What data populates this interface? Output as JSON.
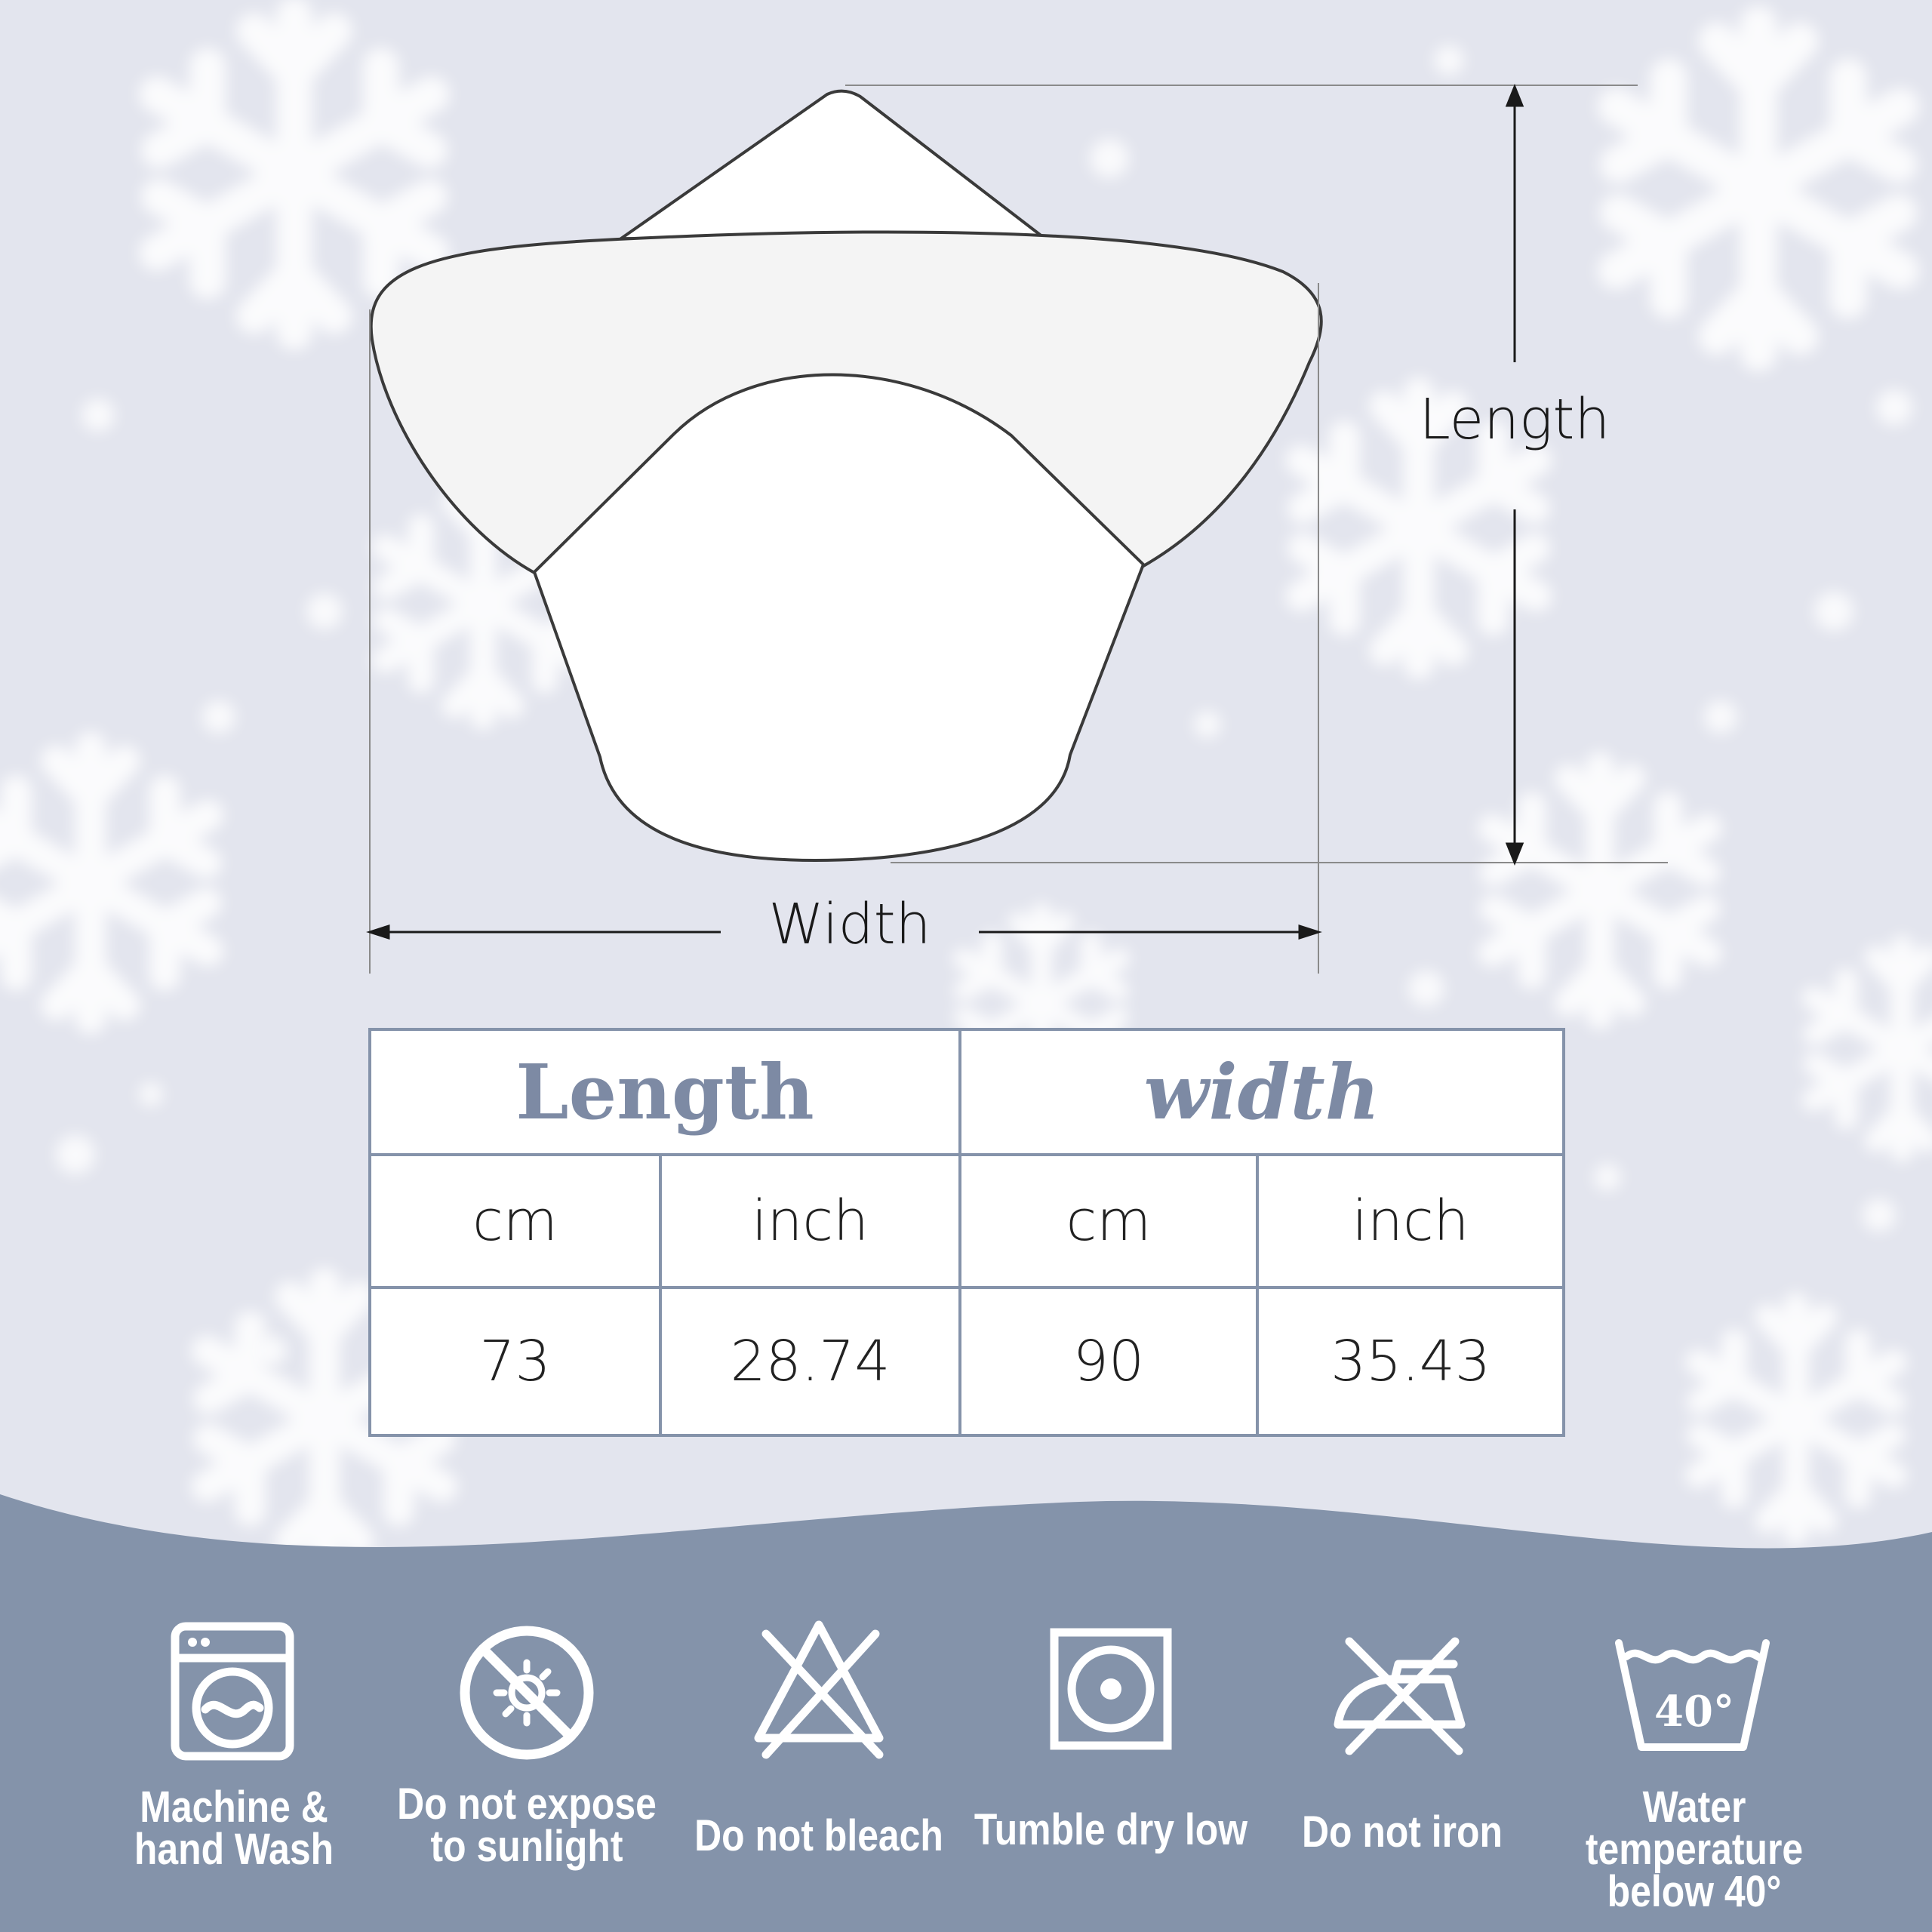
{
  "diagram": {
    "length_label": "Length",
    "width_label": "Width"
  },
  "table": {
    "headers": [
      "Length",
      "width"
    ],
    "units": [
      "cm",
      "inch",
      "cm",
      "inch"
    ],
    "values": [
      "73",
      "28.74",
      "90",
      "35.43"
    ]
  },
  "care": [
    {
      "icon": "washing-machine-icon",
      "label_lines": [
        "Machine &",
        "hand Wash"
      ]
    },
    {
      "icon": "no-sunlight-icon",
      "label_lines": [
        "Do not expose",
        "to sunlight"
      ]
    },
    {
      "icon": "do-not-bleach-icon",
      "label_lines": [
        "Do not bleach"
      ]
    },
    {
      "icon": "tumble-dry-low-icon",
      "label_lines": [
        "Tumble dry low"
      ]
    },
    {
      "icon": "do-not-iron-icon",
      "label_lines": [
        "Do not iron"
      ]
    },
    {
      "icon": "wash-40-icon",
      "label_lines": [
        "Water temperature",
        "below 40°"
      ],
      "icon_text": "40°"
    }
  ],
  "colors": {
    "background": "#e3e5ee",
    "band": "#8493aa",
    "table_border": "#8593aa",
    "table_header_text": "#7d8aa4"
  }
}
